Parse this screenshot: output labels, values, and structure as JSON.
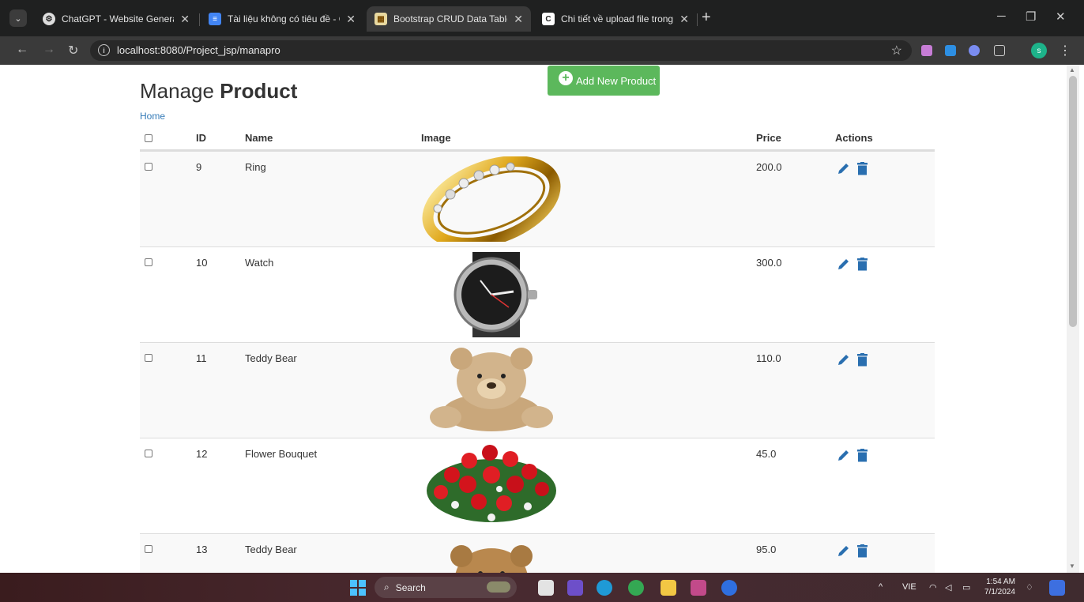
{
  "browser": {
    "tabs": [
      {
        "title": "ChatGPT - Website Generator",
        "favicon": "chatgpt-icon",
        "active": false
      },
      {
        "title": "Tài liệu không có tiêu đề - Goo",
        "favicon": "google-docs-icon",
        "active": false
      },
      {
        "title": "Bootstrap CRUD Data Table for",
        "favicon": "bootstrap-icon",
        "active": true
      },
      {
        "title": "Chi tiết về upload file trong HT",
        "favicon": "c-letter-icon",
        "active": false
      }
    ],
    "favicon_letter": "C",
    "url": "localhost:8080/Project_jsp/manapro",
    "profile_initial": "s"
  },
  "page": {
    "title_light": "Manage",
    "title_bold": "Product",
    "add_button_label": "Add New Product",
    "breadcrumb_home": "Home",
    "columns": [
      "ID",
      "Name",
      "Image",
      "Price",
      "Actions"
    ],
    "products": [
      {
        "id": "9",
        "name": "Ring",
        "image": "gold-ring",
        "price": "200.0"
      },
      {
        "id": "10",
        "name": "Watch",
        "image": "wrist-watch",
        "price": "300.0"
      },
      {
        "id": "11",
        "name": "Teddy Bear",
        "image": "teddy-bear",
        "price": "110.0"
      },
      {
        "id": "12",
        "name": "Flower Bouquet",
        "image": "rose-bouquet",
        "price": "45.0"
      },
      {
        "id": "13",
        "name": "Teddy Bear",
        "image": "teddy-bear",
        "price": "95.0"
      }
    ]
  },
  "taskbar": {
    "search_placeholder": "Search",
    "language": "VIE",
    "time": "1:54 AM",
    "date": "7/1/2024"
  },
  "colors": {
    "success_green": "#5cb85c",
    "link_blue": "#337ab7",
    "action_blue": "#2a6fb0"
  }
}
